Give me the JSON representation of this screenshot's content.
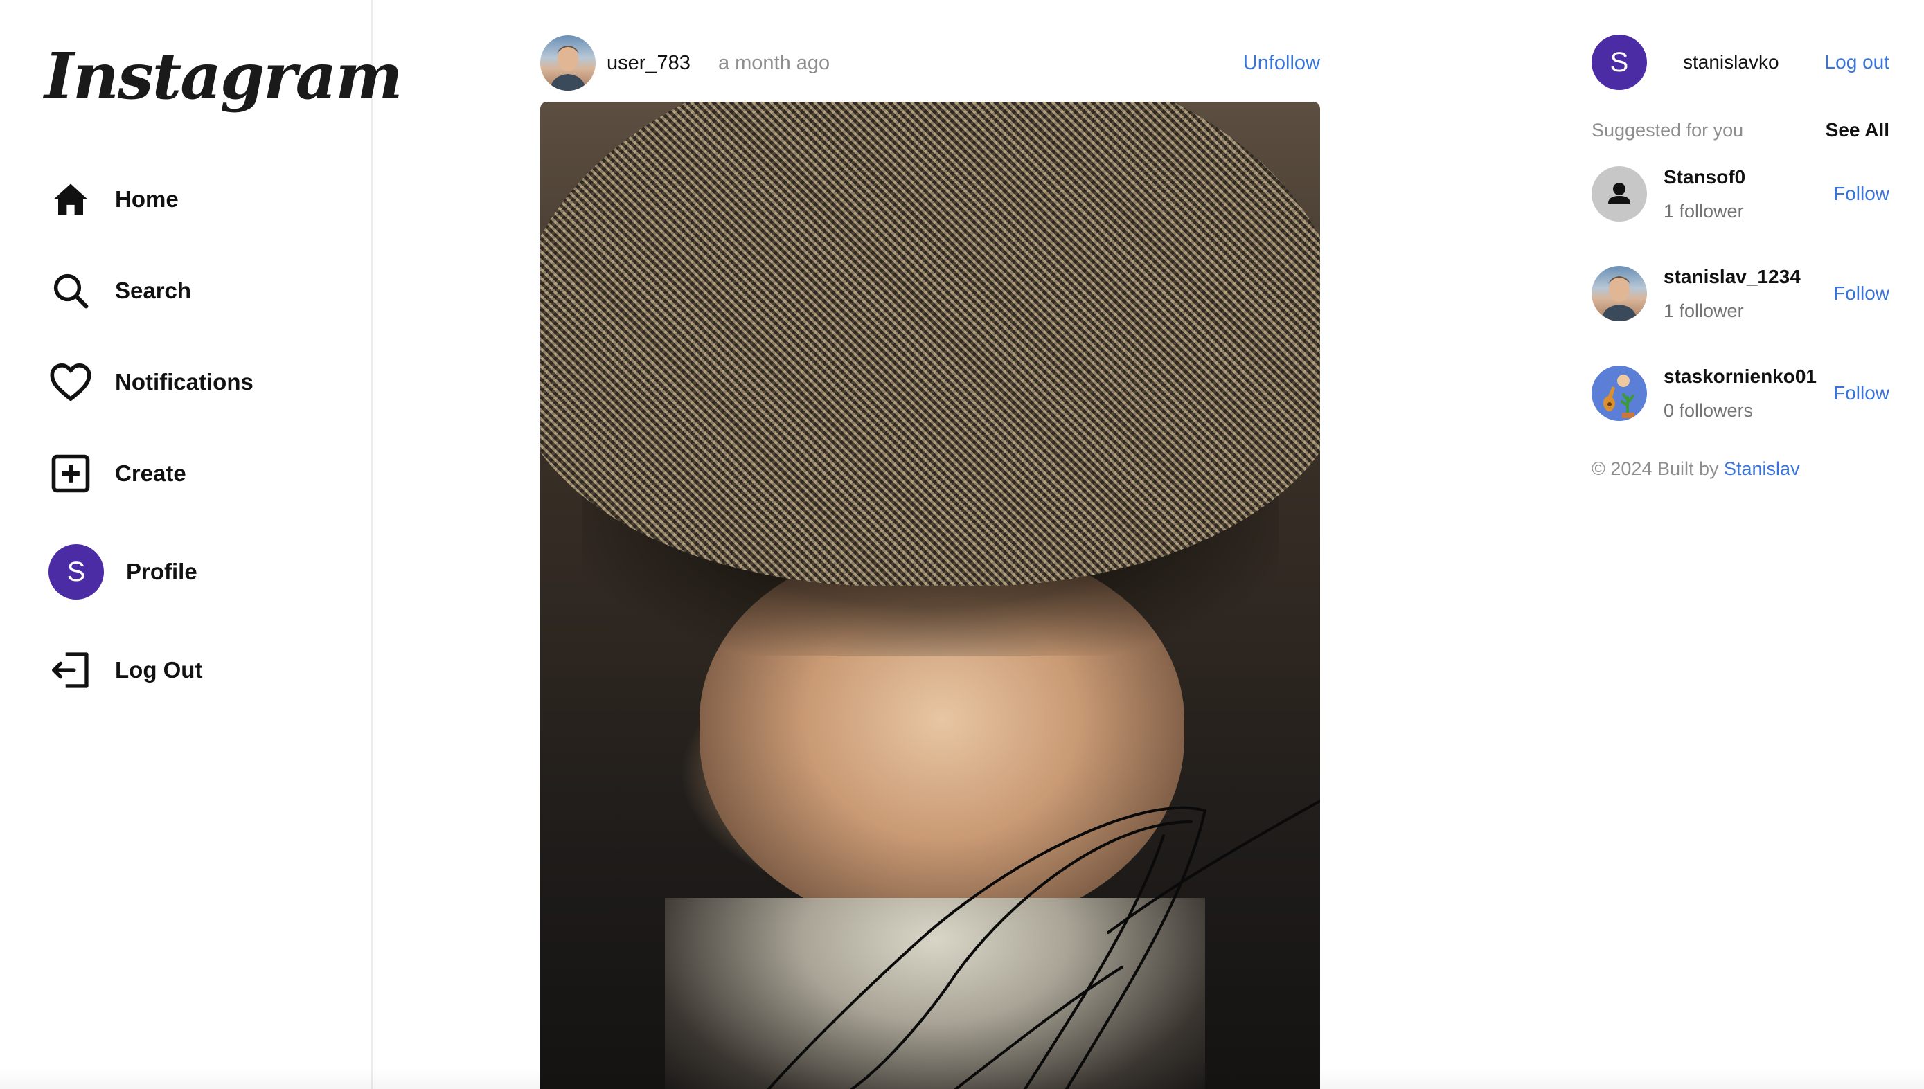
{
  "sidebar": {
    "logo": "Instagram",
    "items": [
      {
        "label": "Home",
        "icon": "home-icon"
      },
      {
        "label": "Search",
        "icon": "search-icon"
      },
      {
        "label": "Notifications",
        "icon": "heart-icon"
      },
      {
        "label": "Create",
        "icon": "plus-square-icon"
      },
      {
        "label": "Profile",
        "icon": "avatar",
        "avatar_letter": "S"
      },
      {
        "label": "Log Out",
        "icon": "logout-icon"
      }
    ]
  },
  "post": {
    "username": "user_783",
    "time": "a month ago",
    "action": "Unfollow"
  },
  "current_user": {
    "avatar_letter": "S",
    "username": "stanislavko",
    "logout": "Log out"
  },
  "suggestions": {
    "title": "Suggested for you",
    "see_all": "See All",
    "items": [
      {
        "name": "Stansof0",
        "followers": "1 follower",
        "action": "Follow",
        "avatar": "default-person"
      },
      {
        "name": "stanislav_1234",
        "followers": "1 follower",
        "action": "Follow",
        "avatar": "photo"
      },
      {
        "name": "staskornienko01",
        "followers": "0 followers",
        "action": "Follow",
        "avatar": "guitar-illustration"
      }
    ]
  },
  "footer": {
    "prefix": "© 2024 Built by ",
    "link": "Stanislav"
  },
  "colors": {
    "accent": "#3a74d9",
    "avatar_bg": "#4b2ca5",
    "muted": "#8e8e8e"
  }
}
